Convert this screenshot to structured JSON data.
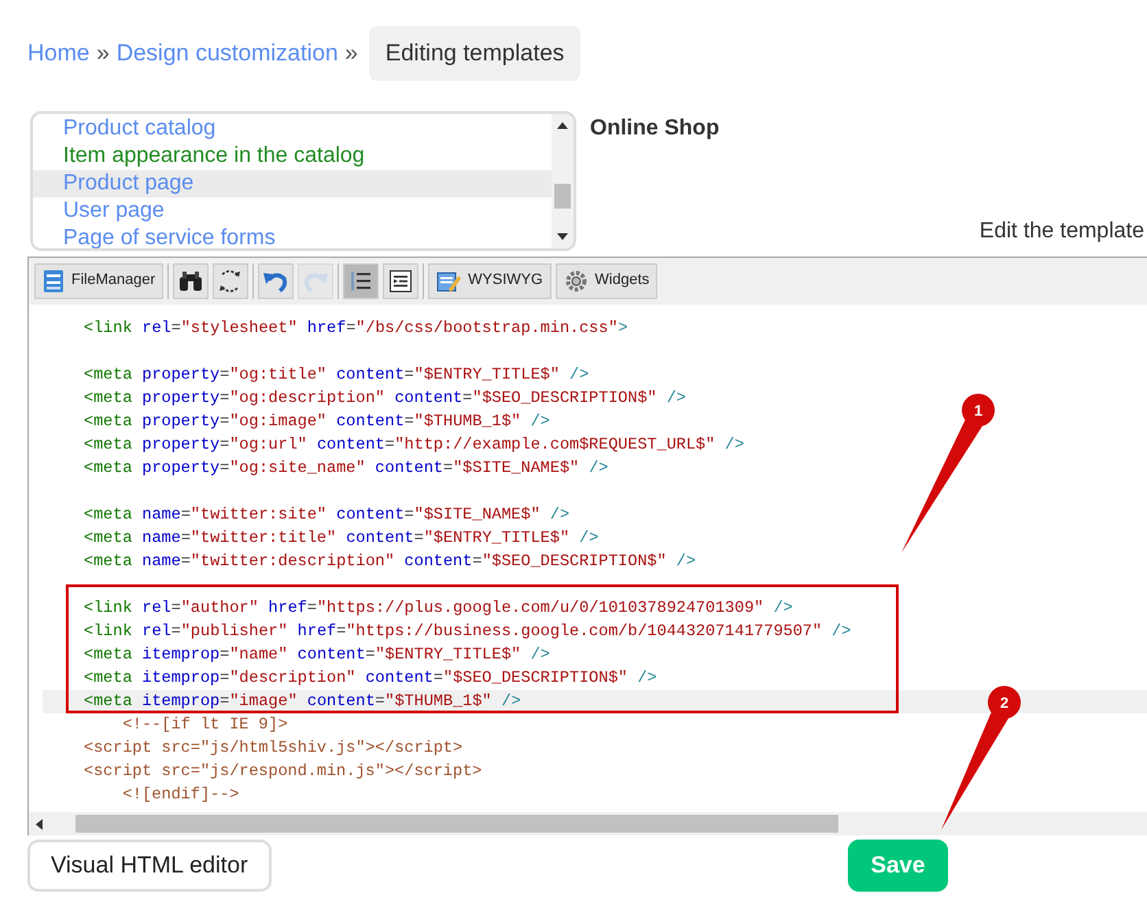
{
  "breadcrumb": {
    "links": [
      "Home",
      "Design customization"
    ],
    "separator": "»",
    "current": "Editing templates"
  },
  "template_list": {
    "items": [
      {
        "label": "Product catalog",
        "color": "#5b8def",
        "selected": false
      },
      {
        "label": "Item appearance in the catalog",
        "color": "#228b22",
        "selected": false
      },
      {
        "label": "Product page",
        "color": "#5b8def",
        "selected": true
      },
      {
        "label": "User page",
        "color": "#5b8def",
        "selected": false
      },
      {
        "label": "Page of service forms",
        "color": "#5b8def",
        "selected": false
      }
    ]
  },
  "site_name": "Online Shop",
  "editor_heading": "Edit the template",
  "toolbar": {
    "groups": [
      [
        {
          "kind": "text",
          "label": "FileManager",
          "selected": false,
          "disabled": false
        }
      ],
      [
        {
          "kind": "icon",
          "selected": false,
          "disabled": false
        },
        {
          "kind": "icon",
          "selected": false,
          "disabled": false
        }
      ],
      [
        {
          "kind": "icon",
          "selected": false,
          "disabled": false
        },
        {
          "kind": "icon",
          "selected": false,
          "disabled": true
        }
      ],
      [
        {
          "kind": "icon",
          "selected": true,
          "disabled": false
        },
        {
          "kind": "icon",
          "selected": false,
          "disabled": false
        }
      ],
      [
        {
          "kind": "text",
          "label": "WYSIWYG",
          "selected": false,
          "disabled": false
        },
        {
          "kind": "text",
          "label": "Widgets",
          "selected": false,
          "disabled": false
        }
      ]
    ]
  },
  "code_lines": [
    {
      "current": false,
      "tokens": [
        {
          "kind": "tag",
          "text": "<link"
        },
        {
          "kind": "attr",
          "text": " rel"
        },
        {
          "kind": "eq",
          "text": "="
        },
        {
          "kind": "val",
          "text": "\"stylesheet\""
        },
        {
          "kind": "attr",
          "text": " href"
        },
        {
          "kind": "eq",
          "text": "="
        },
        {
          "kind": "val",
          "text": "\"/bs/css/bootstrap.min.css\""
        },
        {
          "kind": "end",
          "text": ">"
        }
      ]
    },
    {
      "current": false
    },
    {
      "current": false,
      "tokens": [
        {
          "kind": "tag",
          "text": "<meta"
        },
        {
          "kind": "attr",
          "text": " property"
        },
        {
          "kind": "eq",
          "text": "="
        },
        {
          "kind": "val",
          "text": "\"og:title\""
        },
        {
          "kind": "attr",
          "text": " content"
        },
        {
          "kind": "eq",
          "text": "="
        },
        {
          "kind": "val",
          "text": "\"$ENTRY_TITLE$\""
        },
        {
          "kind": "end",
          "text": " />"
        }
      ]
    },
    {
      "current": false,
      "tokens": [
        {
          "kind": "tag",
          "text": "<meta"
        },
        {
          "kind": "attr",
          "text": " property"
        },
        {
          "kind": "eq",
          "text": "="
        },
        {
          "kind": "val",
          "text": "\"og:description\""
        },
        {
          "kind": "attr",
          "text": " content"
        },
        {
          "kind": "eq",
          "text": "="
        },
        {
          "kind": "val",
          "text": "\"$SEO_DESCRIPTION$\""
        },
        {
          "kind": "end",
          "text": " />"
        }
      ]
    },
    {
      "current": false,
      "tokens": [
        {
          "kind": "tag",
          "text": "<meta"
        },
        {
          "kind": "attr",
          "text": " property"
        },
        {
          "kind": "eq",
          "text": "="
        },
        {
          "kind": "val",
          "text": "\"og:image\""
        },
        {
          "kind": "attr",
          "text": " content"
        },
        {
          "kind": "eq",
          "text": "="
        },
        {
          "kind": "val",
          "text": "\"$THUMB_1$\""
        },
        {
          "kind": "end",
          "text": " />"
        }
      ]
    },
    {
      "current": false,
      "tokens": [
        {
          "kind": "tag",
          "text": "<meta"
        },
        {
          "kind": "attr",
          "text": " property"
        },
        {
          "kind": "eq",
          "text": "="
        },
        {
          "kind": "val",
          "text": "\"og:url\""
        },
        {
          "kind": "attr",
          "text": " content"
        },
        {
          "kind": "eq",
          "text": "="
        },
        {
          "kind": "val",
          "text": "\"http://example.com$REQUEST_URL$\""
        },
        {
          "kind": "end",
          "text": " />"
        }
      ]
    },
    {
      "current": false,
      "tokens": [
        {
          "kind": "tag",
          "text": "<meta"
        },
        {
          "kind": "attr",
          "text": " property"
        },
        {
          "kind": "eq",
          "text": "="
        },
        {
          "kind": "val",
          "text": "\"og:site_name\""
        },
        {
          "kind": "attr",
          "text": " content"
        },
        {
          "kind": "eq",
          "text": "="
        },
        {
          "kind": "val",
          "text": "\"$SITE_NAME$\""
        },
        {
          "kind": "end",
          "text": " />"
        }
      ]
    },
    {
      "current": false
    },
    {
      "current": false,
      "tokens": [
        {
          "kind": "tag",
          "text": "<meta"
        },
        {
          "kind": "attr",
          "text": " name"
        },
        {
          "kind": "eq",
          "text": "="
        },
        {
          "kind": "val",
          "text": "\"twitter:site\""
        },
        {
          "kind": "attr",
          "text": " content"
        },
        {
          "kind": "eq",
          "text": "="
        },
        {
          "kind": "val",
          "text": "\"$SITE_NAME$\""
        },
        {
          "kind": "end",
          "text": " />"
        }
      ]
    },
    {
      "current": false,
      "tokens": [
        {
          "kind": "tag",
          "text": "<meta"
        },
        {
          "kind": "attr",
          "text": " name"
        },
        {
          "kind": "eq",
          "text": "="
        },
        {
          "kind": "val",
          "text": "\"twitter:title\""
        },
        {
          "kind": "attr",
          "text": " content"
        },
        {
          "kind": "eq",
          "text": "="
        },
        {
          "kind": "val",
          "text": "\"$ENTRY_TITLE$\""
        },
        {
          "kind": "end",
          "text": " />"
        }
      ]
    },
    {
      "current": false,
      "tokens": [
        {
          "kind": "tag",
          "text": "<meta"
        },
        {
          "kind": "attr",
          "text": " name"
        },
        {
          "kind": "eq",
          "text": "="
        },
        {
          "kind": "val",
          "text": "\"twitter:description\""
        },
        {
          "kind": "attr",
          "text": " content"
        },
        {
          "kind": "eq",
          "text": "="
        },
        {
          "kind": "val",
          "text": "\"$SEO_DESCRIPTION$\""
        },
        {
          "kind": "end",
          "text": " />"
        }
      ]
    },
    {
      "current": false
    },
    {
      "current": false,
      "tokens": [
        {
          "kind": "tag",
          "text": "<link"
        },
        {
          "kind": "attr",
          "text": " rel"
        },
        {
          "kind": "eq",
          "text": "="
        },
        {
          "kind": "val",
          "text": "\"author\""
        },
        {
          "kind": "attr",
          "text": " href"
        },
        {
          "kind": "eq",
          "text": "="
        },
        {
          "kind": "val",
          "text": "\"https://plus.google.com/u/0/1010378924701309\""
        },
        {
          "kind": "end",
          "text": " />"
        }
      ]
    },
    {
      "current": false,
      "tokens": [
        {
          "kind": "tag",
          "text": "<link"
        },
        {
          "kind": "attr",
          "text": " rel"
        },
        {
          "kind": "eq",
          "text": "="
        },
        {
          "kind": "val",
          "text": "\"publisher\""
        },
        {
          "kind": "attr",
          "text": " href"
        },
        {
          "kind": "eq",
          "text": "="
        },
        {
          "kind": "val",
          "text": "\"https://business.google.com/b/10443207141779507\""
        },
        {
          "kind": "end",
          "text": " />"
        }
      ]
    },
    {
      "current": false,
      "tokens": [
        {
          "kind": "tag",
          "text": "<meta"
        },
        {
          "kind": "attr",
          "text": " itemprop"
        },
        {
          "kind": "eq",
          "text": "="
        },
        {
          "kind": "val",
          "text": "\"name\""
        },
        {
          "kind": "attr",
          "text": " content"
        },
        {
          "kind": "eq",
          "text": "="
        },
        {
          "kind": "val",
          "text": "\"$ENTRY_TITLE$\""
        },
        {
          "kind": "end",
          "text": " />"
        }
      ]
    },
    {
      "current": false,
      "tokens": [
        {
          "kind": "tag",
          "text": "<meta"
        },
        {
          "kind": "attr",
          "text": " itemprop"
        },
        {
          "kind": "eq",
          "text": "="
        },
        {
          "kind": "val",
          "text": "\"description\""
        },
        {
          "kind": "attr",
          "text": " content"
        },
        {
          "kind": "eq",
          "text": "="
        },
        {
          "kind": "val",
          "text": "\"$SEO_DESCRIPTION$\""
        },
        {
          "kind": "end",
          "text": " />"
        }
      ]
    },
    {
      "current": true,
      "tokens": [
        {
          "kind": "tag",
          "text": "<meta"
        },
        {
          "kind": "attr",
          "text": " itemprop"
        },
        {
          "kind": "eq",
          "text": "="
        },
        {
          "kind": "val",
          "text": "\"image\""
        },
        {
          "kind": "attr",
          "text": " content"
        },
        {
          "kind": "eq",
          "text": "="
        },
        {
          "kind": "val",
          "text": "\"$THUMB_1$\""
        },
        {
          "kind": "end",
          "text": " />"
        }
      ]
    },
    {
      "current": false,
      "tokens": [
        {
          "kind": "misc",
          "text": "    <!--[if lt IE 9]>"
        }
      ]
    },
    {
      "current": false,
      "tokens": [
        {
          "kind": "misc",
          "text": "<script src=\"js/html5shiv.js\"></script>"
        }
      ]
    },
    {
      "current": false,
      "tokens": [
        {
          "kind": "misc",
          "text": "<script src=\"js/respond.min.js\"></script>"
        }
      ]
    },
    {
      "current": false,
      "tokens": [
        {
          "kind": "misc",
          "text": "    <![endif]-->"
        }
      ]
    }
  ],
  "buttons": [
    {
      "kind": "secondary",
      "label": "Visual HTML editor"
    },
    {
      "kind": "primary",
      "label": "Save"
    }
  ],
  "callouts": [
    "1",
    "2"
  ]
}
